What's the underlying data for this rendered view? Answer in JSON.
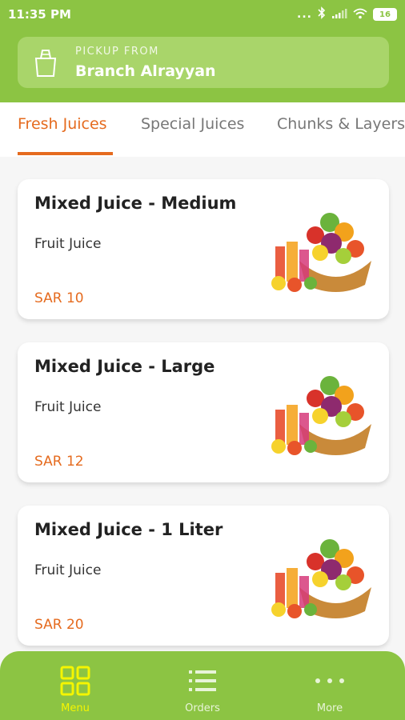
{
  "status_bar": {
    "time": "11:35 PM",
    "more": "...",
    "battery": "16"
  },
  "pickup": {
    "label": "PICKUP FROM",
    "branch": "Branch Alrayyan"
  },
  "tabs": [
    {
      "label": "Fresh Juices",
      "active": true
    },
    {
      "label": "Special Juices",
      "active": false
    },
    {
      "label": "Chunks & Layers",
      "active": false
    }
  ],
  "products": [
    {
      "name": "Mixed Juice - Medium",
      "category": "Fruit Juice",
      "price": "SAR 10"
    },
    {
      "name": "Mixed Juice - Large",
      "category": "Fruit Juice",
      "price": "SAR 12"
    },
    {
      "name": "Mixed Juice - 1 Liter",
      "category": "Fruit Juice",
      "price": "SAR 20"
    }
  ],
  "bottom_nav": [
    {
      "label": "Menu",
      "icon": "grid-icon",
      "active": true
    },
    {
      "label": "Orders",
      "icon": "list-icon",
      "active": false
    },
    {
      "label": "More",
      "icon": "more-dots-icon",
      "active": false
    }
  ],
  "colors": {
    "brand_green": "#8cc443",
    "accent_orange": "#e56b1f",
    "active_nav": "#f5f500"
  }
}
